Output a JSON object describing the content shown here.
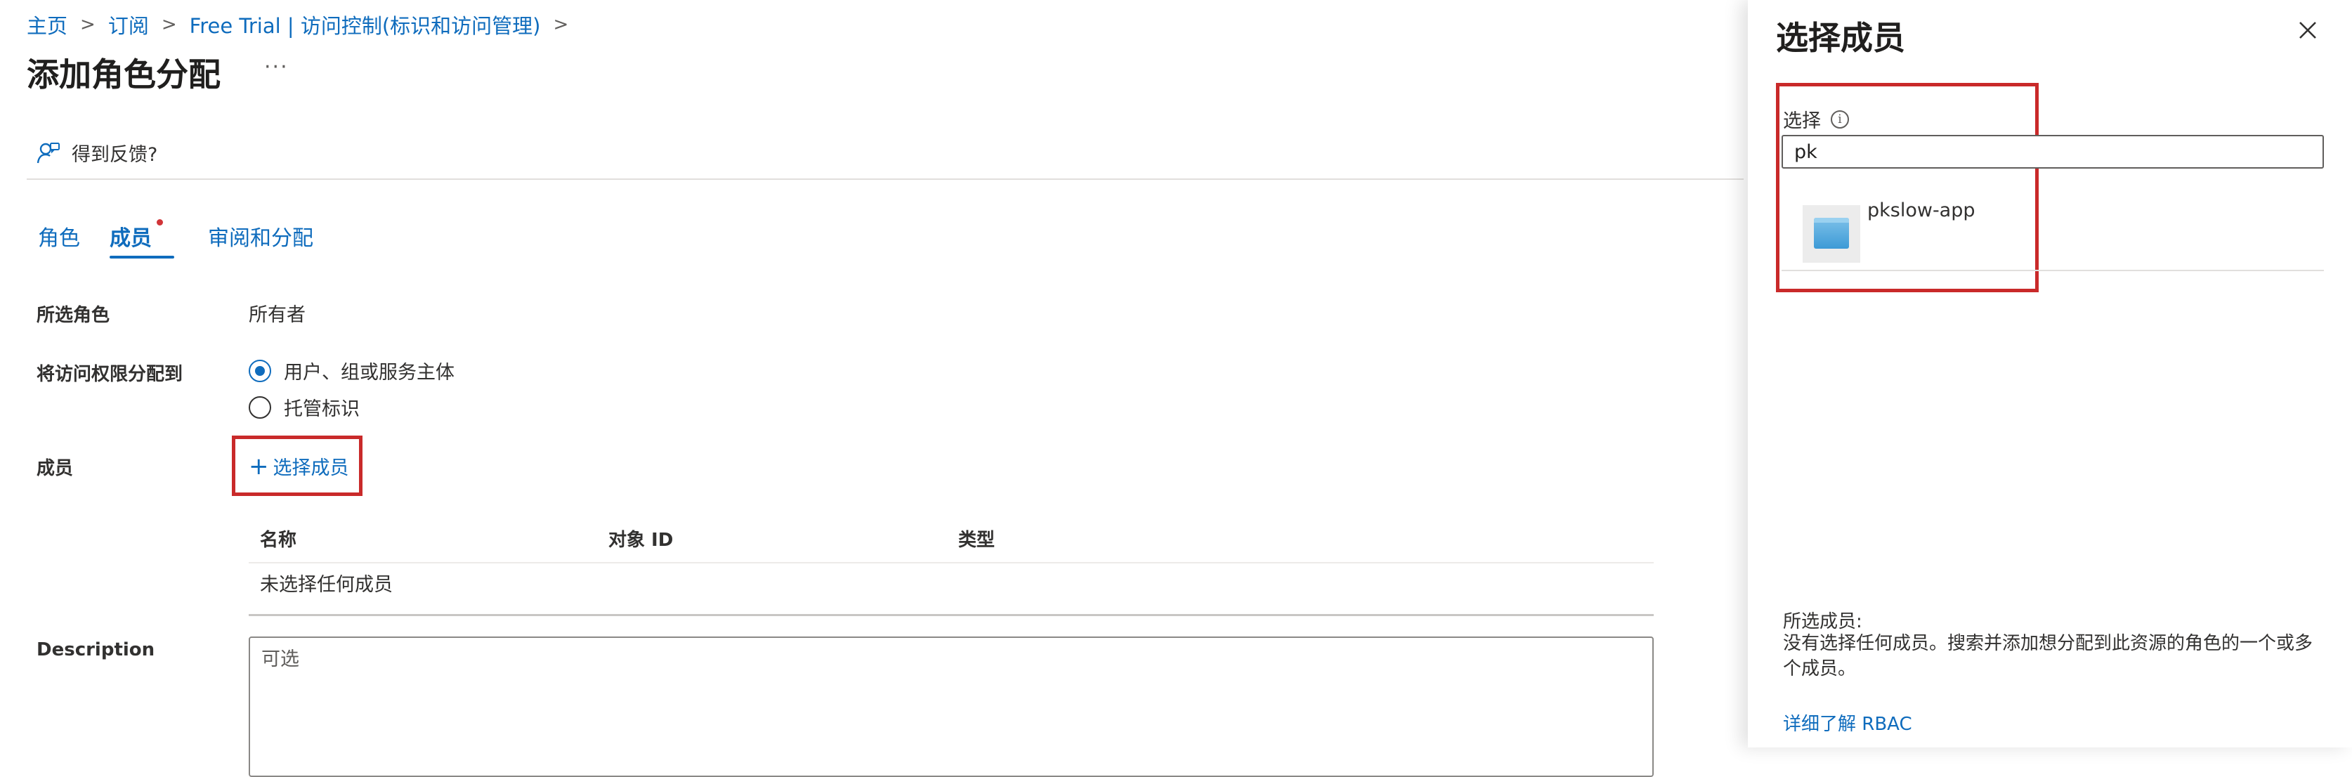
{
  "breadcrumb": {
    "items": [
      "主页",
      "订阅",
      "Free Trial | 访问控制(标识和访问管理)"
    ],
    "separator": ">"
  },
  "page": {
    "title": "添加角色分配",
    "more": "···"
  },
  "feedback": {
    "label": "得到反馈?",
    "icon": "feedback-person-icon"
  },
  "tabs": [
    {
      "label": "角色"
    },
    {
      "label": "成员",
      "active": true,
      "has_indicator": true
    },
    {
      "label": "审阅和分配"
    }
  ],
  "form": {
    "role_label": "所选角色",
    "role_value": "所有者",
    "assign_label": "将访问权限分配到",
    "assign_options": [
      {
        "label": "用户、组或服务主体",
        "checked": true
      },
      {
        "label": "托管标识",
        "checked": false
      }
    ],
    "members_label": "成员",
    "select_members_link": "选择成员",
    "plus": "+",
    "table": {
      "columns": [
        "名称",
        "对象 ID",
        "类型"
      ],
      "empty_text": "未选择任何成员"
    },
    "description_label": "Description",
    "description_placeholder": "可选"
  },
  "panel": {
    "title": "选择成员",
    "select_label": "选择",
    "info_glyph": "i",
    "search_value": "pk",
    "results": [
      {
        "name": "pkslow-app",
        "icon": "app-registration-icon"
      }
    ],
    "selected_label": "所选成员:",
    "selected_empty": "没有选择任何成员。搜索并添加想分配到此资源的角色的一个或多个成员。",
    "learn_more": "详细了解 RBAC"
  },
  "colors": {
    "accent": "#0f6cbd",
    "highlight_box": "#c92a2a",
    "indicator_dot": "#d13438"
  }
}
